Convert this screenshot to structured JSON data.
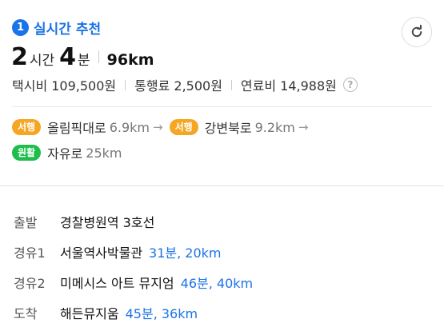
{
  "route": {
    "rank": "1",
    "title": "실시간 추천",
    "hours": "2",
    "hours_unit": "시간",
    "minutes": "4",
    "minutes_unit": "분",
    "distance": "96km"
  },
  "fees": {
    "taxi": "택시비 109,500원",
    "toll": "통행료 2,500원",
    "fuel": "연료비 14,988원"
  },
  "roads": [
    {
      "badge": "서행",
      "name": "올림픽대로",
      "dist": "6.9km",
      "arrow": "→"
    },
    {
      "badge": "서행",
      "name": "강변북로",
      "dist": "9.2km",
      "arrow": "→"
    },
    {
      "badge": "원활",
      "name": "자유로",
      "dist": "25km"
    }
  ],
  "waypoints": [
    {
      "label": "출발",
      "name": "경찰병원역 3호선",
      "eta": ""
    },
    {
      "label": "경유1",
      "name": "서울역사박물관",
      "eta": "31분, 20km"
    },
    {
      "label": "경유2",
      "name": "미메시스 아트 뮤지엄",
      "eta": "46분, 40km"
    },
    {
      "label": "도착",
      "name": "해든뮤지움",
      "eta": "45분, 36km"
    }
  ],
  "icons": {
    "refresh": "refresh-icon",
    "help": "question-icon",
    "arrow": "arrow-right-icon"
  },
  "colors": {
    "accent": "#1a73e8",
    "slow": "#f5a623",
    "smooth": "#1fbe4c"
  }
}
